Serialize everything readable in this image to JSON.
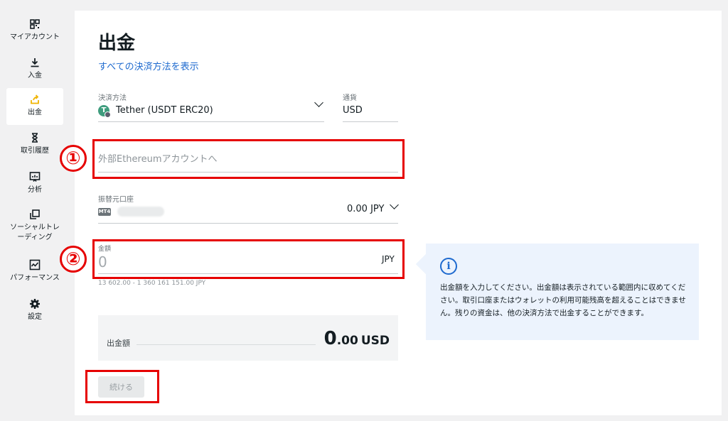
{
  "sidebar": {
    "items": [
      {
        "label": "マイアカウント",
        "icon": "qr-grid-icon"
      },
      {
        "label": "入金",
        "icon": "download-icon"
      },
      {
        "label": "出金",
        "icon": "upload-icon",
        "active": true
      },
      {
        "label": "取引履歴",
        "icon": "hourglass-icon"
      },
      {
        "label": "分析",
        "icon": "chart-icon"
      },
      {
        "label": "ソーシャルトレーディング",
        "icon": "copy-icon"
      },
      {
        "label": "パフォーマンス",
        "icon": "performance-icon"
      },
      {
        "label": "設定",
        "icon": "gear-icon"
      }
    ]
  },
  "main": {
    "title": "出金",
    "all_methods_link": "すべての決済方法を表示",
    "payment_method": {
      "label": "決済方法",
      "value": "Tether (USDT ERC20)"
    },
    "currency": {
      "label": "通貨",
      "value": "USD"
    },
    "external_account": {
      "placeholder": "外部Ethereumアカウントへ"
    },
    "source_account": {
      "label": "振替元口座",
      "badge": "MT4",
      "balance": "0.00 JPY"
    },
    "amount": {
      "label": "金額",
      "value": "0",
      "currency": "JPY",
      "range": "13 602.00 - 1 360 161 151.00 JPY"
    },
    "info": {
      "text": "出金額を入力してください。出金額は表示されている範囲内に収めてください。取引口座またはウォレットの利用可能残高を超えることはできません。残りの資金は、他の決済方法で出金することができます。"
    },
    "summary": {
      "label": "出金額",
      "amount_int": "0",
      "amount_dec": ".00",
      "currency": "USD"
    },
    "continue_button": "続ける"
  },
  "annotations": {
    "marker_1": "①",
    "marker_2": "②"
  },
  "colors": {
    "accent": "#1e6acf",
    "highlight_red": "#e60000",
    "info_bg": "#ecf3fd"
  }
}
